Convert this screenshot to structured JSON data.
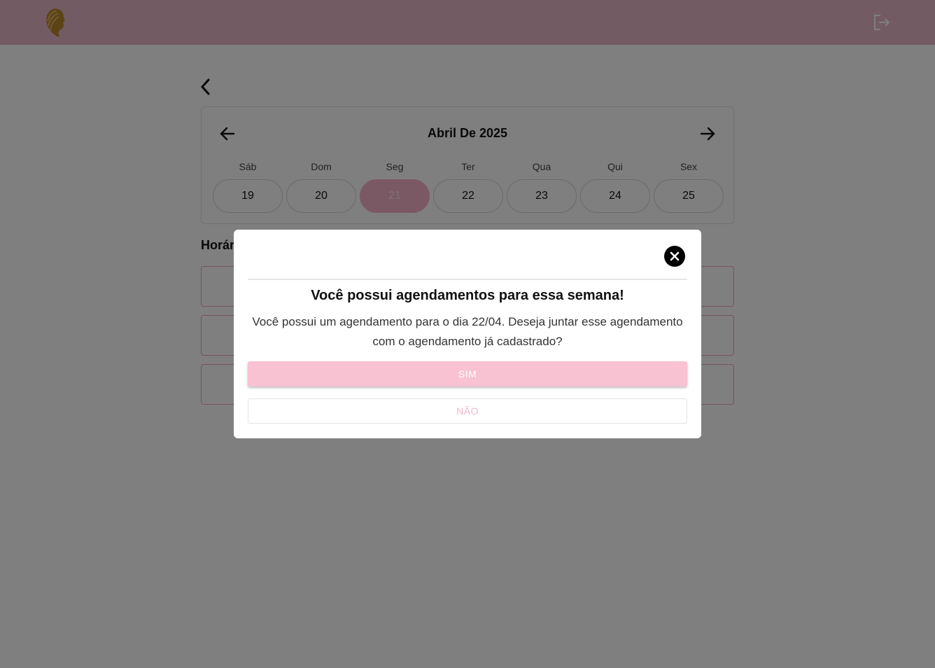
{
  "header": {
    "logo_icon": "woman-profile-logo",
    "logout_icon": "logout-icon"
  },
  "calendar": {
    "title": "Abril De 2025",
    "days": [
      {
        "name": "Sáb",
        "number": "19",
        "selected": false
      },
      {
        "name": "Dom",
        "number": "20",
        "selected": false
      },
      {
        "name": "Seg",
        "number": "21",
        "selected": true
      },
      {
        "name": "Ter",
        "number": "22",
        "selected": false
      },
      {
        "name": "Qua",
        "number": "23",
        "selected": false
      },
      {
        "name": "Qui",
        "number": "24",
        "selected": false
      },
      {
        "name": "Sex",
        "number": "25",
        "selected": false
      }
    ]
  },
  "times": {
    "title": "Horár"
  },
  "modal": {
    "title": "Você possui agendamentos para essa semana!",
    "message": "Você possui um agendamento para o dia 22/04. Deseja juntar esse agendamento com o agendamento já cadastrado?",
    "yes_label": "SIM",
    "no_label": "NÃO"
  },
  "colors": {
    "header": "#e7b6c9",
    "accent": "#f6b3c8",
    "overlay": "rgba(0,0,0,0.5)"
  }
}
